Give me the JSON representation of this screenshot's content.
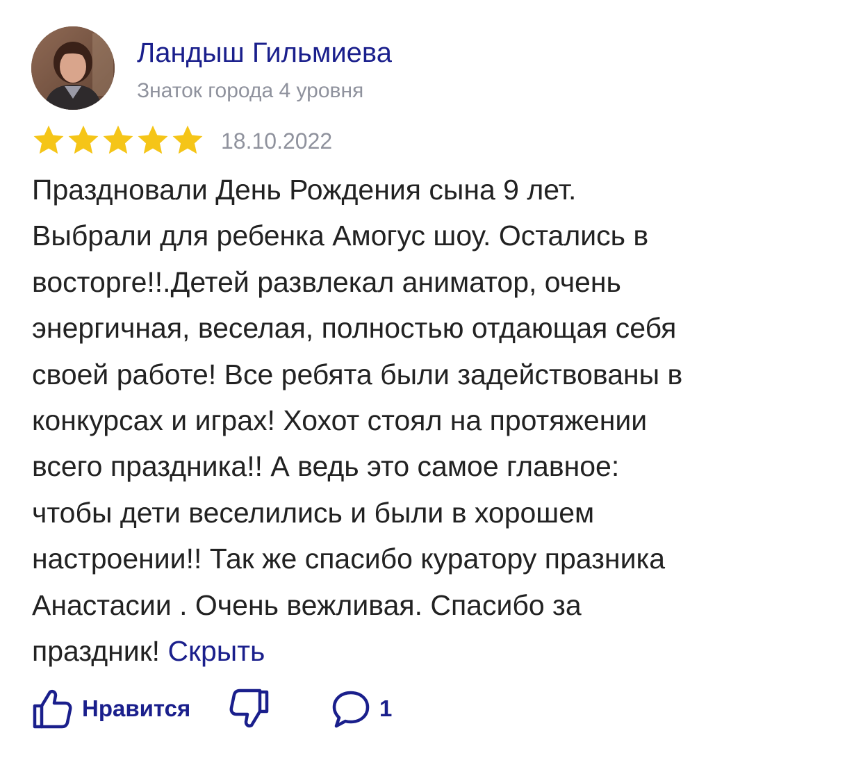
{
  "author": {
    "name": "Ландыш Гильмиева",
    "level": "Знаток города 4 уровня",
    "avatar_icon": "user-photo"
  },
  "review": {
    "rating": 5,
    "rating_max": 5,
    "date": "18.10.2022",
    "lines": [
      "Праздновали День Рождения сына 9 лет.",
      "Выбрали для ребенка Амогус шоу. Остались в",
      "восторге!!.Детей развлекал аниматор, очень",
      "энергичная, веселая, полностью отдающая себя",
      "своей работе! Все ребята были задействованы в",
      "конкурсах и играх! Хохот стоял на протяжении",
      "всего праздника!! А ведь это самое главное:",
      "чтобы дети веселились и были в хорошем",
      "настроении!! Так же спасибо куратору празника",
      "Анастасии . Очень вежливая. Спасибо за",
      "праздник!"
    ],
    "hide_label": "Скрыть"
  },
  "actions": {
    "like_label": "Нравится",
    "like_icon": "thumbs-up-icon",
    "dislike_icon": "thumbs-down-icon",
    "comment_icon": "comment-icon",
    "comment_count": "1"
  },
  "colors": {
    "accent": "#1a1f8c",
    "star": "#f5c518",
    "muted": "#8f929d",
    "text": "#222222"
  }
}
